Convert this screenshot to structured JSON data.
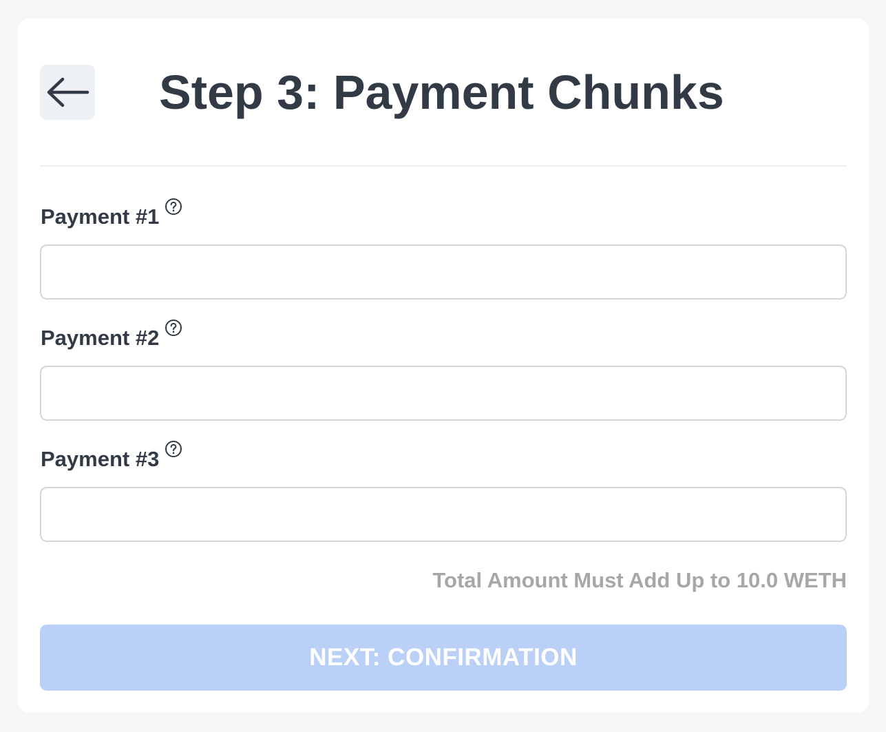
{
  "header": {
    "back_icon": "arrow-left-icon",
    "title": "Step 3: Payment Chunks"
  },
  "fields": [
    {
      "label": "Payment #1",
      "help_icon": "question-circle-icon",
      "value": "",
      "placeholder": ""
    },
    {
      "label": "Payment #2",
      "help_icon": "question-circle-icon",
      "value": "",
      "placeholder": ""
    },
    {
      "label": "Payment #3",
      "help_icon": "question-circle-icon",
      "value": "",
      "placeholder": ""
    }
  ],
  "total_note": "Total Amount Must Add Up to 10.0 WETH",
  "next_button": {
    "label": "NEXT: CONFIRMATION",
    "disabled": true
  },
  "colors": {
    "background": "#f5f6f8",
    "card": "#ffffff",
    "text": "#323a46",
    "muted": "#a6a7aa",
    "button_disabled": "#bbd0f6",
    "back_button_bg": "#edf1f6"
  }
}
